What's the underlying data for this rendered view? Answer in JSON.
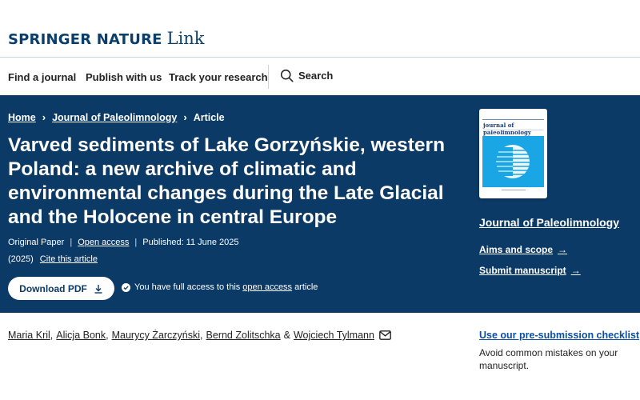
{
  "brand": {
    "name": "SPRINGER NATURE",
    "suffix": "Link"
  },
  "nav": {
    "items": [
      "Find a journal",
      "Publish with us",
      "Track your research"
    ],
    "search": "Search"
  },
  "breadcrumb": {
    "home": "Home",
    "journal": "Journal of Paleolimnology",
    "current": "Article"
  },
  "article": {
    "title": "Varved sediments of Lake Gorzyńskie, western Poland: a new archive of climatic and environmental changes during the Late Glacial and the Holocene in central Europe",
    "type": "Original Paper",
    "access": "Open access",
    "published": "Published: 11 June 2025",
    "year": "(2025)",
    "cite": "Cite this article",
    "download": "Download PDF",
    "access_note_pre": "You have full access to this",
    "access_note_link": "open access",
    "access_note_post": "article",
    "authors": [
      "Maria Kril",
      "Alicja Bonk",
      "Maurycy Żarczyński",
      "Bernd Zolitschka",
      "Wojciech Tylmann"
    ],
    "author_joiner": "&"
  },
  "sidebar": {
    "cover_title": "journal of paleolimnology",
    "journal": "Journal of Paleolimnology",
    "aims": "Aims and scope",
    "submit": "Submit manuscript",
    "checklist": "Use our pre-submission checklist",
    "checklist_desc": "Avoid common mistakes on your manuscript."
  },
  "colors": {
    "hero": "#0b3a66",
    "brand": "#0b3f6b",
    "link": "#0b4fa3",
    "cover_band": "#1aa6e4"
  },
  "icons": {
    "search": "search-icon",
    "download": "download-icon",
    "check": "check-circle-icon",
    "mail": "envelope-icon",
    "arrow": "arrow-right-icon"
  }
}
